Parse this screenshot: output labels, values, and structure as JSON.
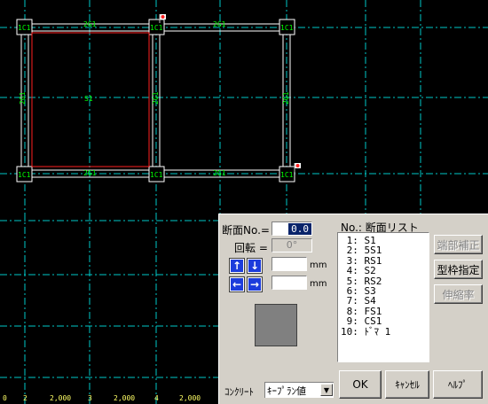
{
  "cad": {
    "center_labels": [
      "S1"
    ],
    "beam_labels_h": [
      "2G1",
      "2G1",
      "2G1",
      "2G1"
    ],
    "beam_labels_v": [
      "2G1",
      "2G1",
      "2G1",
      "2G1"
    ],
    "column_labels": [
      "1C1",
      "1C1",
      "1C1",
      "1C1",
      "1C1",
      "1C1"
    ],
    "grid_numbers": [
      "0",
      "2",
      "3",
      "4"
    ],
    "dimensions": [
      "2,000",
      "2,000",
      "2,000"
    ],
    "colors": {
      "grid_line": "#00c8c8",
      "member_line": "#ffffff",
      "selected": "#ff2020",
      "label": "#00ff00",
      "dimension": "#ffff66"
    }
  },
  "dialog": {
    "section_no_label": "断面No.=",
    "section_no_value": "0.0",
    "rotation_label": "回転 =",
    "rotation_value": "0°",
    "unit_mm_1": "mm",
    "unit_mm_2": "mm",
    "up_arrow": "↑",
    "down_arrow": "↓",
    "left_arrow": "←",
    "right_arrow": "→",
    "list_header": "No.: 断面リスト",
    "list_items": [
      " 1: S1",
      " 2: 5S1",
      " 3: RS1",
      " 4: S2",
      " 5: RS2",
      " 6: S3",
      " 7: S4",
      " 8: FS1",
      " 9: CS1",
      "10: ﾄﾞﾏ 1"
    ],
    "btn_end_correction": "端部補正",
    "btn_formwork": "型枠指定",
    "btn_extension": "伸縮率",
    "concrete_label": "ｺﾝｸﾘｰﾄ",
    "concrete_value": "ｷｰﾌﾟﾗﾝ値",
    "ok": "OK",
    "cancel": "ｷｬﾝｾﾙ",
    "help": "ﾍﾙﾌﾟ"
  }
}
